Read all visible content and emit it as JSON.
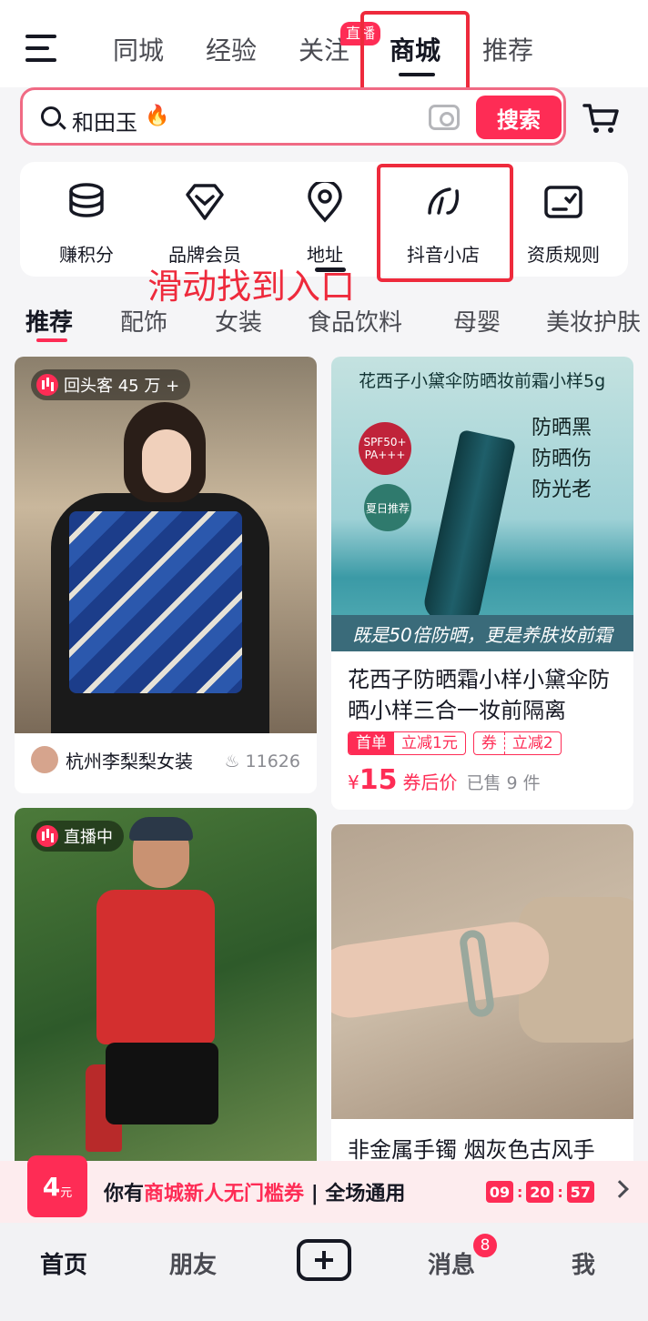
{
  "topnav": {
    "tabs": [
      {
        "label": "同城"
      },
      {
        "label": "经验"
      },
      {
        "label": "关注"
      },
      {
        "label": "商城"
      },
      {
        "label": "推荐"
      }
    ],
    "live_badge": "直播"
  },
  "search": {
    "query": "和田玉",
    "button_label": "搜索"
  },
  "quick_links": [
    {
      "label": "赚积分",
      "icon": "coins-stack-icon"
    },
    {
      "label": "品牌会员",
      "icon": "diamond-heart-icon"
    },
    {
      "label": "地址",
      "icon": "location-pin-icon"
    },
    {
      "label": "抖音小店",
      "icon": "shop-logo-icon"
    },
    {
      "label": "资质规则",
      "icon": "certificate-check-icon"
    }
  ],
  "annotation": "滑动找到入口",
  "categories": [
    "推荐",
    "配饰",
    "女装",
    "食品饮料",
    "母婴",
    "美妆护肤"
  ],
  "cards": {
    "c1": {
      "badge": "回头客 45 万 +",
      "author": "杭州李梨梨女装",
      "likes": "11626"
    },
    "c2": {
      "image_title": "花西子小黛伞防晒妆前霜小样5g",
      "spf": "SPF50+ PA+++",
      "summer": "夏日推荐",
      "claims": [
        "防晒黑",
        "防晒伤",
        "防光老"
      ],
      "banner": "既是50倍防晒，更是养肤妆前霜",
      "title": "花西子防晒霜小样小黛伞防晒小样三合一妆前隔离",
      "tag1_a": "首单",
      "tag1_b": "立减1元",
      "tag2_a": "券",
      "tag2_b": "立减2",
      "currency": "¥",
      "price": "15",
      "price_note": "券后价",
      "sold": "已售 9 件"
    },
    "c3": {
      "badge": "直播中"
    },
    "c4": {
      "title": "非金属手镯 烟灰色古风手"
    }
  },
  "coupon": {
    "badge_value": "4",
    "badge_unit": "元",
    "text_pre": "你有",
    "text_hl": "商城新人无门槛券",
    "text_sep": "|",
    "text_post": "全场通用",
    "timer": [
      "09",
      "20",
      "57"
    ]
  },
  "tabbar": {
    "home": "首页",
    "friends": "朋友",
    "messages": "消息",
    "messages_badge": "8",
    "me": "我"
  },
  "colors": {
    "accent": "#fe2c55",
    "annotation": "#ee2a3c"
  }
}
